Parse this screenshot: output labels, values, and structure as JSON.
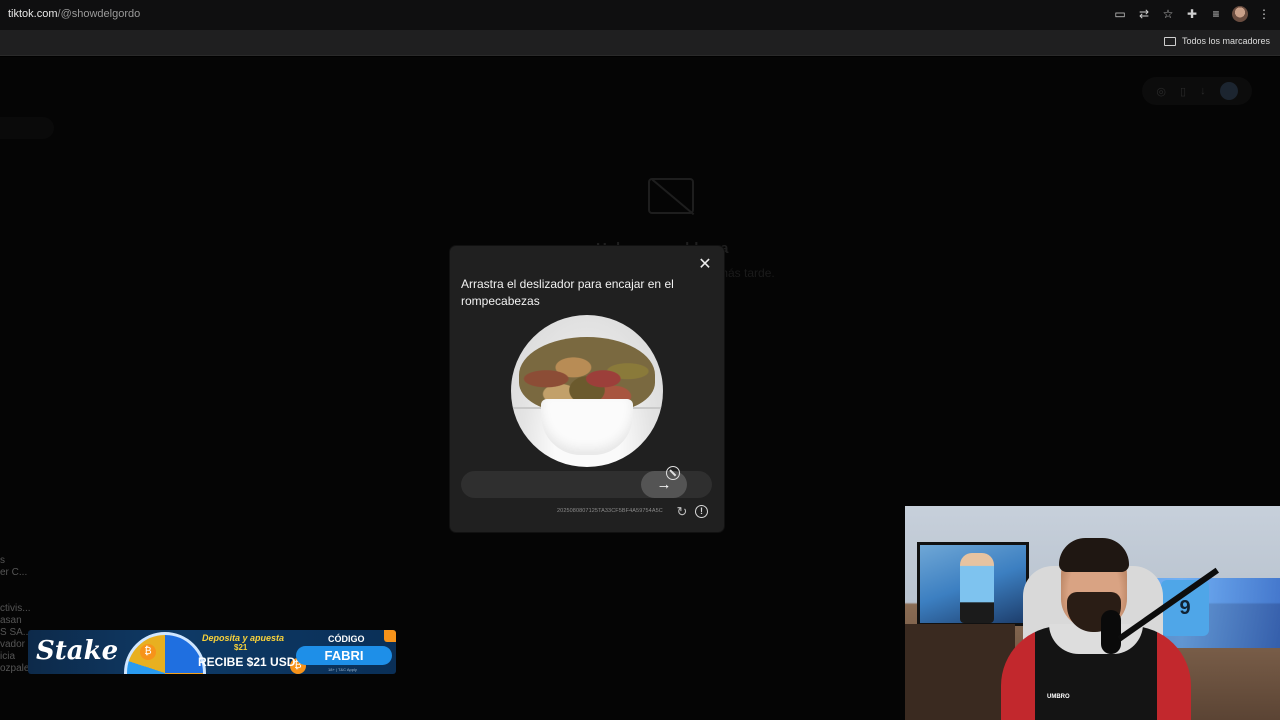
{
  "browser": {
    "url_domain": "tiktok.com",
    "url_path": "/@showdelgordo",
    "bookmarks_all_label": "Todos los marcadores"
  },
  "page": {
    "error_title": "Hubo un problema",
    "error_subtitle": "o más tarde.",
    "side_items": [
      "s",
      "er C...",
      "",
      "",
      "ctivis...",
      "asan",
      "S SA...",
      "vador",
      "icia",
      "ozpalen..."
    ]
  },
  "captcha": {
    "title": "Arrastra el deslizador para encajar en el rompecabezas",
    "slider_arrow": "→",
    "captcha_id": "2025080807125TA33CF5BF4A59754A5C",
    "refresh_symbol": "↻",
    "info_symbol": "!"
  },
  "ad": {
    "brand": "Stake",
    "line1": "Deposita y apuesta",
    "line2": "$21",
    "line3": "RECIBE $21 USD",
    "code_label": "CÓDIGO",
    "code": "FABRI",
    "fine_print": "18+ | T&C Apply"
  },
  "webcam": {
    "jersey_number": "9",
    "hoodie_logo": "UMBRO"
  }
}
